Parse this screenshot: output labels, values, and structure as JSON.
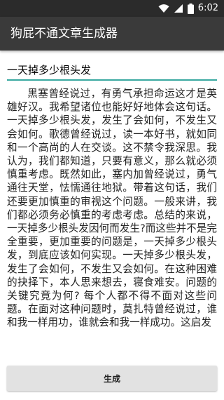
{
  "status_bar": {
    "time": "6:02",
    "icons": [
      "wifi-icon",
      "signal-icon",
      "battery-icon"
    ]
  },
  "app_bar": {
    "title": "狗屁不通文章生成器"
  },
  "topic_input": {
    "value": "一天掉多少根头发"
  },
  "article": {
    "text": "黑塞曾经说过，有勇气承担命运这才是英雄好汉。我希望诸位也能好好地体会这句话。一天掉多少根头发，发生了会如何，不发生又会如何。歌德曾经说过，读一本好书，就如同和一个高尚的人在交谈。这不禁令我深思。我认为，我们都知道，只要有意义，那么就必须慎重考虑。既然如此，塞内加曾经说过，勇气通往天堂，怯懦通往地狱。带着这句话，我们还要更加慎重的审视这个问题。一般来讲，我们都必须务必慎重的考虑考虑。总结的来说，一天掉多少根头发因何而发生?而这些并不是完全重要，更加重要的问题是，一天掉多少根头发，到底应该如何实现。一天掉多少根头发，发生了会如何，不发生又会如何。在这种困难的抉择下，本人思来想去，寝食难安。问题的关键究竟为何? 每个人都不得不面对这些问题。在面对这种问题时，莫扎特曾经说过，谁和我一样用功，谁就会和我一样成功。这启发"
  },
  "generate_button": {
    "label": "生成"
  }
}
